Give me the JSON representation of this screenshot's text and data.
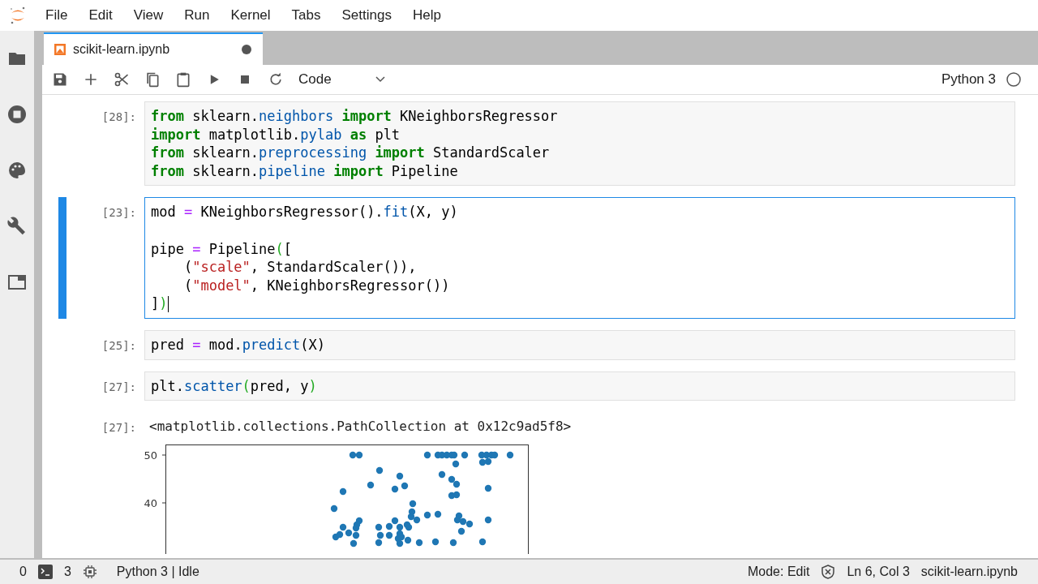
{
  "menu": [
    "File",
    "Edit",
    "View",
    "Run",
    "Kernel",
    "Tabs",
    "Settings",
    "Help"
  ],
  "tab": {
    "title": "scikit-learn.ipynb",
    "unsaved": true
  },
  "toolbar": {
    "cell_type": "Code",
    "kernel": "Python 3"
  },
  "cells": [
    {
      "prompt": "[28]:",
      "selected": false,
      "lines": [
        {
          "tokens": [
            {
              "kind": "kw",
              "t": "from"
            },
            {
              "kind": "plain",
              "t": " sklearn."
            },
            {
              "kind": "prop",
              "t": "neighbors"
            },
            {
              "kind": "kw",
              "t": " import"
            },
            {
              "kind": "plain",
              "t": " KNeighborsRegressor"
            }
          ]
        },
        {
          "tokens": [
            {
              "kind": "kw",
              "t": "import"
            },
            {
              "kind": "plain",
              "t": " matplotlib."
            },
            {
              "kind": "prop",
              "t": "pylab"
            },
            {
              "kind": "kw",
              "t": " as"
            },
            {
              "kind": "plain",
              "t": " plt"
            }
          ]
        },
        {
          "tokens": [
            {
              "kind": "kw",
              "t": "from"
            },
            {
              "kind": "plain",
              "t": " sklearn."
            },
            {
              "kind": "prop",
              "t": "preprocessing"
            },
            {
              "kind": "kw",
              "t": " import"
            },
            {
              "kind": "plain",
              "t": " StandardScaler"
            }
          ]
        },
        {
          "tokens": [
            {
              "kind": "kw",
              "t": "from"
            },
            {
              "kind": "plain",
              "t": " sklearn."
            },
            {
              "kind": "prop",
              "t": "pipeline"
            },
            {
              "kind": "kw",
              "t": " import"
            },
            {
              "kind": "plain",
              "t": " Pipeline"
            }
          ]
        }
      ]
    },
    {
      "prompt": "[23]:",
      "selected": true,
      "lines": [
        {
          "tokens": [
            {
              "kind": "plain",
              "t": "mod "
            },
            {
              "kind": "op",
              "t": "="
            },
            {
              "kind": "plain",
              "t": " KNeighborsRegressor()."
            },
            {
              "kind": "prop",
              "t": "fit"
            },
            {
              "kind": "plain",
              "t": "(X, y)"
            }
          ]
        },
        {
          "blank_before": true,
          "tokens": [
            {
              "kind": "plain",
              "t": "pipe "
            },
            {
              "kind": "op",
              "t": "="
            },
            {
              "kind": "plain",
              "t": " Pipeline"
            },
            {
              "kind": "match",
              "t": "("
            },
            {
              "kind": "plain",
              "t": "["
            }
          ]
        },
        {
          "tokens": [
            {
              "kind": "plain",
              "t": "    ("
            },
            {
              "kind": "str",
              "t": "\"scale\""
            },
            {
              "kind": "plain",
              "t": ", StandardScaler()),"
            }
          ]
        },
        {
          "tokens": [
            {
              "kind": "plain",
              "t": "    ("
            },
            {
              "kind": "str",
              "t": "\"model\""
            },
            {
              "kind": "plain",
              "t": ", KNeighborsRegressor())"
            }
          ]
        },
        {
          "tokens": [
            {
              "kind": "plain",
              "t": "]"
            },
            {
              "kind": "match",
              "t": ")"
            }
          ]
        }
      ]
    },
    {
      "prompt": "[25]:",
      "selected": false,
      "lines": [
        {
          "tokens": [
            {
              "kind": "plain",
              "t": "pred "
            },
            {
              "kind": "op",
              "t": "="
            },
            {
              "kind": "plain",
              "t": " mod."
            },
            {
              "kind": "prop",
              "t": "predict"
            },
            {
              "kind": "plain",
              "t": "(X)"
            }
          ]
        }
      ]
    },
    {
      "prompt": "[27]:",
      "selected": false,
      "lines": [
        {
          "tokens": [
            {
              "kind": "plain",
              "t": "plt."
            },
            {
              "kind": "prop",
              "t": "scatter"
            },
            {
              "kind": "match",
              "t": "("
            },
            {
              "kind": "plain",
              "t": "pred, y"
            },
            {
              "kind": "match",
              "t": ")"
            }
          ]
        }
      ]
    }
  ],
  "output": {
    "prompt": "[27]:",
    "text": "<matplotlib.collections.PathCollection at 0x12c9ad5f8>",
    "plot": {
      "ytick_labels": [
        "50",
        "40"
      ]
    }
  },
  "status_bar": {
    "left_count": "0",
    "terminals": "3",
    "kernel_status": "Python 3 | Idle",
    "mode": "Mode: Edit",
    "cursor": "Ln 6, Col 3",
    "file": "scikit-learn.ipynb"
  }
}
